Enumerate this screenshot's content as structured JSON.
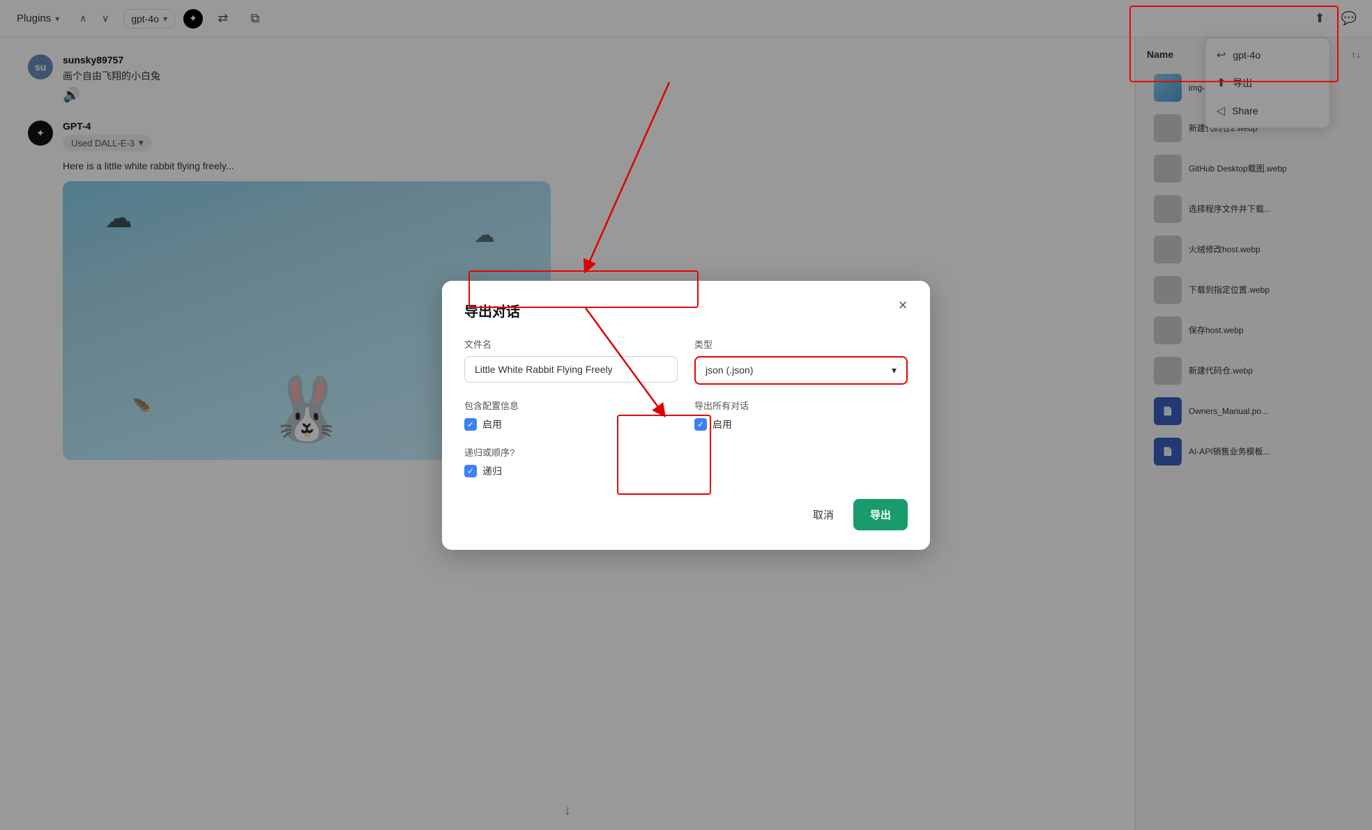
{
  "topbar": {
    "plugins_label": "Plugins",
    "model_label": "gpt-4o",
    "openai_icon": "✦"
  },
  "dropdown": {
    "items": [
      {
        "id": "gpt4o",
        "icon": "↩",
        "label": "gpt-4o"
      },
      {
        "id": "export",
        "icon": "⬆",
        "label": "导出"
      },
      {
        "id": "share",
        "icon": "◁",
        "label": "Share"
      }
    ]
  },
  "chat": {
    "user": {
      "name": "sunsky89757",
      "avatar_initials": "su",
      "message": "画个自由飞翔的小白兔",
      "audio_icon": "🔊"
    },
    "gpt": {
      "name": "GPT-4",
      "model_badge": "Used DALL-E-3",
      "message_partial": "Here is"
    }
  },
  "sidebar": {
    "title": "Name",
    "sort_label": "↑↓",
    "files": [
      {
        "id": 1,
        "name": "img-6a83834d-2baf-...",
        "type": "image"
      },
      {
        "id": 2,
        "name": "新建代码仓2.webp",
        "type": "gray"
      },
      {
        "id": 3,
        "name": "GitHub Desktop载图.webp",
        "type": "gray"
      },
      {
        "id": 4,
        "name": "选择程序文件并下载...",
        "type": "gray"
      },
      {
        "id": 5,
        "name": "火绒修改host.webp",
        "type": "gray"
      },
      {
        "id": 6,
        "name": "下载到指定位置.webp",
        "type": "gray"
      },
      {
        "id": 7,
        "name": "保存host.webp",
        "type": "gray"
      },
      {
        "id": 8,
        "name": "新建代码仓.webp",
        "type": "gray"
      },
      {
        "id": 9,
        "name": "Owners_Manual.po...",
        "type": "doc"
      },
      {
        "id": 10,
        "name": "AI-API销售业务模板...",
        "type": "doc"
      }
    ]
  },
  "dialog": {
    "title": "导出对话",
    "close_label": "×",
    "filename_label": "文件名",
    "filename_value": "Little White Rabbit Flying Freely",
    "type_label": "类型",
    "type_value": "json (.json)",
    "include_config_label": "包含配置信息",
    "include_config_checkbox_label": "启用",
    "export_all_label": "导出所有对话",
    "export_all_checkbox_label": "启用",
    "order_label": "递归或顺序?",
    "order_checkbox_label": "递归",
    "cancel_label": "取消",
    "export_button_label": "导出"
  }
}
